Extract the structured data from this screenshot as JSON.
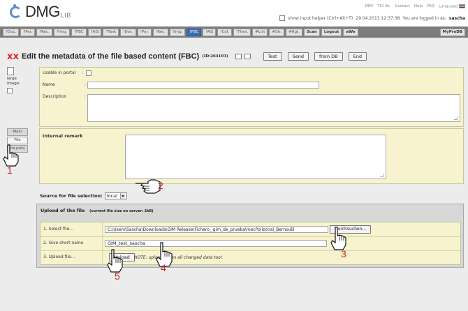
{
  "app": {
    "logo_text": "DMG",
    "logo_sub": "LIB",
    "top_links": [
      "DBV",
      "TUI lib.",
      "Contact",
      "Help",
      "FAQ",
      "Language"
    ],
    "input_helper_label": "show input helper (Ctrl+Alt+T)",
    "datetime": "29.04.2013 12:37:38",
    "logged_in_label": "You are logged in as:",
    "username": "sascha"
  },
  "nav": {
    "tabs": [
      "?Doc.",
      "?Per.",
      "?Rec.",
      "?Img.",
      "?FBC",
      "?AIS",
      "?Task",
      "!Doc.",
      "!Per.",
      "!Rec.",
      "!Img.",
      "!FBC",
      "!AIS",
      "!Col.",
      "!Thes.",
      "#List",
      "#Str.",
      "#Rgt.",
      "Scan",
      "Logout",
      "aWe"
    ],
    "active_tab": "!FBC",
    "right_tab": "MyProDB"
  },
  "header": {
    "marks": "XX",
    "title": "Edit the metadata of the file based content (FBC)",
    "id": "(ID:264103)",
    "buttons": {
      "test": "Test",
      "send": "Send",
      "from_db": "from DB",
      "end": "End"
    }
  },
  "side": {
    "large_image_label": "large image:"
  },
  "metadata": {
    "usable_label": "Usable in portal",
    "name_label": "Name",
    "name_value": "",
    "description_label": "Description",
    "description_value": ""
  },
  "left_tabs": [
    "Main",
    "File",
    "Ins.prov."
  ],
  "remark": {
    "label": "Internal remark",
    "value": ""
  },
  "source": {
    "label": "Source for file selection:",
    "value": "local"
  },
  "upload": {
    "title": "Upload of the file",
    "size_note": "(current file size on server: 2kB)",
    "step1_label": "1. Select file...",
    "file_path": "C:\\Users\\Sascha\\Downloads\\GIM Release\\Fichero_ gim_de_prueba\\mecPolizonal_Bernoulli",
    "browse_label": "Durchsuchen...",
    "step2_label": "2. Give short name",
    "short_name": "GIM_test_sascha",
    "step3_label": "3. Upload file...",
    "upload_button": "Upload",
    "note": "NOTE: upload saves all changed data too!"
  },
  "annotations": [
    "1",
    "2",
    "3",
    "4",
    "5"
  ]
}
